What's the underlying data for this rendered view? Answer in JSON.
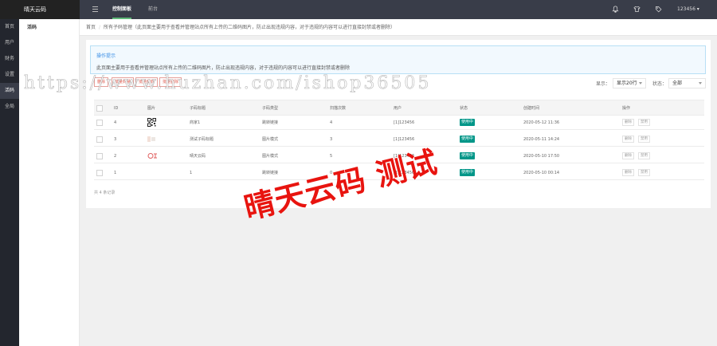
{
  "app": {
    "logo": "晴天云码"
  },
  "topnav": [
    {
      "label": "控制面板",
      "active": true
    },
    {
      "label": "前台",
      "active": false
    }
  ],
  "topicons": [
    "bell-icon",
    "shirt-icon",
    "tag-icon"
  ],
  "user": {
    "name": "123456 ▾"
  },
  "sidebar": [
    {
      "label": "首页",
      "active": false
    },
    {
      "label": "用户",
      "active": false
    },
    {
      "label": "财务",
      "active": false
    },
    {
      "label": "设置",
      "active": false
    },
    {
      "label": "活码",
      "active": true
    },
    {
      "label": "全局",
      "active": false
    }
  ],
  "subsidebar": {
    "item": "活码"
  },
  "breadcrumb": {
    "home": "首页",
    "sep": "/",
    "current": "所有子码管理（此页面主要用于查看并管理站点所有上传的二维码图片，防止出现违规内容，对于违规的内容可以进行直接封禁或者删除）"
  },
  "tip": {
    "title": "操作提示",
    "text": "此页面主要用于查看并管理站点所有上传的二维码图片，防止出现违规内容，对于违规的内容可以进行直接封禁或者删除"
  },
  "actions": {
    "b1": "删除",
    "b2": "批量封禁",
    "b3": "批量解封",
    "b4": "批量删除"
  },
  "controls": {
    "show_label": "显示：",
    "show_value": "显示20行",
    "status_label": "状态：",
    "status_value": "全部"
  },
  "table": {
    "headers": {
      "id": "ID",
      "img": "图片",
      "title": "子码标题",
      "type": "子码类型",
      "scans": "扫描次数",
      "user": "用户",
      "status": "状态",
      "created": "创建时间",
      "ops": "操作"
    },
    "rows": [
      {
        "id": "4",
        "thumb": "qr",
        "title": "商家1",
        "type": "跳转链接",
        "scans": "4",
        "user": "[1]123456",
        "status": "使用中",
        "created": "2020-05-12 11:36",
        "op1": "删除",
        "op2": "禁用"
      },
      {
        "id": "3",
        "thumb": "faint",
        "title": "测试子码标题",
        "type": "图片模式",
        "scans": "3",
        "user": "[1]123456",
        "status": "使用中",
        "created": "2020-05-11 14:24",
        "op1": "删除",
        "op2": "禁用"
      },
      {
        "id": "2",
        "thumb": "logo",
        "title": "晴天云码",
        "type": "图片模式",
        "scans": "5",
        "user": "[1]123456",
        "status": "使用中",
        "created": "2020-05-10 17:50",
        "op1": "删除",
        "op2": "禁用"
      },
      {
        "id": "1",
        "thumb": "none",
        "title": "1",
        "type": "跳转链接",
        "scans": "0",
        "user": "[1]123456",
        "status": "使用中",
        "created": "2020-05-10 00:14",
        "op1": "删除",
        "op2": "禁用"
      }
    ]
  },
  "footer": {
    "count": "共 4 条记录"
  },
  "watermarks": {
    "url": "https://www.huzhan.com/ishop36505",
    "test": "晴天云码 测试"
  },
  "colors": {
    "accent": "#009688",
    "danger": "#e05c4f",
    "watermark": "#e8140f"
  }
}
